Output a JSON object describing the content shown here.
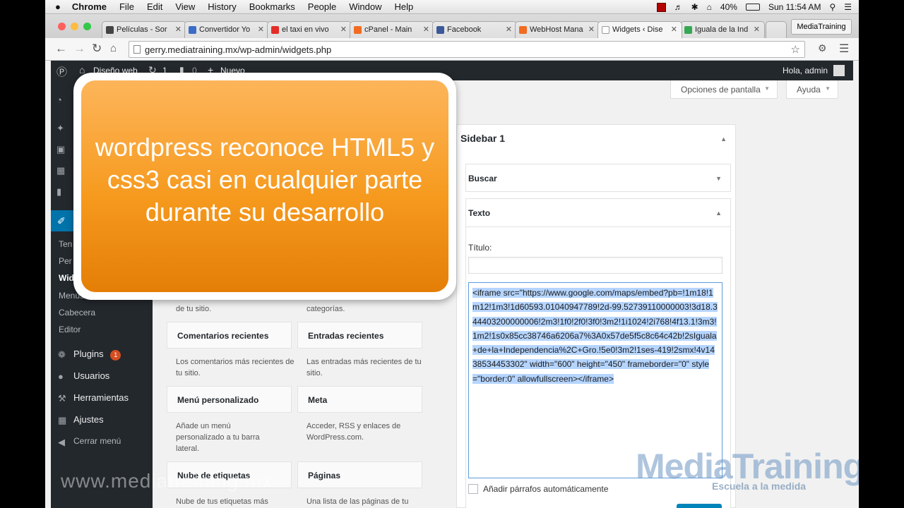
{
  "mac_menu": {
    "app": "Chrome",
    "items": [
      "File",
      "Edit",
      "View",
      "History",
      "Bookmarks",
      "People",
      "Window",
      "Help"
    ],
    "battery": "40%",
    "clock": "Sun 11:54 AM"
  },
  "tabs": [
    {
      "label": "Películas - Sor",
      "color": "#444444"
    },
    {
      "label": "Convertidor Yo",
      "color": "#3b6cc8"
    },
    {
      "label": "el taxi en vivo",
      "color": "#e52d27"
    },
    {
      "label": "cPanel - Main",
      "color": "#f26b21"
    },
    {
      "label": "Facebook",
      "color": "#3b5998"
    },
    {
      "label": "WebHost Mana",
      "color": "#f26b21"
    },
    {
      "label": "Widgets ‹ Dise",
      "color": "#ffffff"
    },
    {
      "label": "Iguala de la Ind",
      "color": "#34a853"
    }
  ],
  "profile_button": "MediaTraining",
  "address_bar": "gerry.mediatraining.mx/wp-admin/widgets.php",
  "admin_bar": {
    "site_name": "Diseño web",
    "updates_count": "1",
    "comments_count": "0",
    "new_label": "Nuevo",
    "greeting": "Hola, admin"
  },
  "sidebar_menu": {
    "appearance_sub": [
      "Ten",
      "Per",
      "Wid",
      "Menús",
      "Cabecera",
      "Editor"
    ],
    "items": [
      {
        "label": "Plugins",
        "badge": "1",
        "icon": "plug-icon"
      },
      {
        "label": "Usuarios",
        "icon": "user-icon"
      },
      {
        "label": "Herramientas",
        "icon": "wrench-icon"
      },
      {
        "label": "Ajustes",
        "icon": "settings-icon"
      },
      {
        "label": "Cerrar menú",
        "icon": "collapse-icon"
      }
    ]
  },
  "screen_options": "Opciones de pantalla",
  "help": "Ayuda",
  "available_widgets": {
    "partial_desc_left": "de tu sitio.",
    "partial_desc_right": "categorías.",
    "widgets": [
      {
        "title": "Comentarios recientes",
        "desc": "Los comentarios más recientes de tu sitio."
      },
      {
        "title": "Entradas recientes",
        "desc": "Las entradas más recientes de tu sitio."
      },
      {
        "title": "Menú personalizado",
        "desc": "Añade un menú personalizado a tu barra lateral."
      },
      {
        "title": "Meta",
        "desc": "Acceder, RSS y enlaces de WordPress.com."
      },
      {
        "title": "Nube de etiquetas",
        "desc": "Nube de tus etiquetas más"
      },
      {
        "title": "Páginas",
        "desc": "Una lista de las páginas de tu"
      }
    ]
  },
  "sidebar_panel": {
    "title": "Sidebar 1",
    "widgets": [
      "Buscar",
      "Texto"
    ],
    "title_label": "Título:",
    "code": "<iframe src=\"https://www.google.com/maps/embed?pb=!1m18!1m12!1m3!1d60593.01040947789!2d-99.52739110000003!3d18.344403200000006!2m3!1f0!2f0!3f0!3m2!1i1024!2i768!4f13.1!3m3!1m2!1s0x85cc38746a6206a7%3A0x57de5f5c8c64c42b!2sIguala+de+la+Independencia%2C+Gro.!5e0!3m2!1ses-419!2smx!4v1438534453302\" width=\"600\" height=\"450\" frameborder=\"0\" style=\"border:0\" allowfullscreen></iframe>",
    "auto_paragraph": "Añadir párrafos automáticamente"
  },
  "overlay_caption": "wordpress reconoce HTML5 y css3 casi en cualquier parte durante su desarrollo",
  "watermark_url": "www.mediatraining.mx",
  "watermark_brand": "MediaTraining",
  "watermark_tagline": "Escuela a la medida"
}
